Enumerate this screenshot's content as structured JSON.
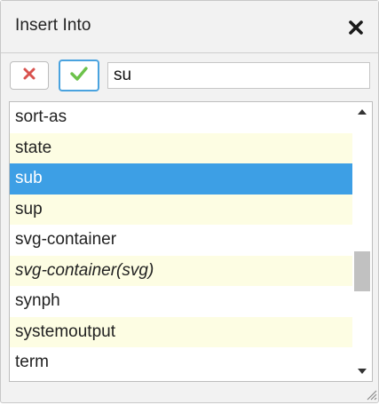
{
  "dialog": {
    "title": "Insert Into"
  },
  "toolbar": {
    "search_value": "su"
  },
  "list": {
    "items": [
      "sort-as",
      "state",
      "sub",
      "sup",
      "svg-container",
      "svg-container(svg)",
      "synph",
      "systemoutput",
      "term"
    ],
    "selected": "sub"
  },
  "colors": {
    "selection": "#3d9fe5",
    "alt_row": "#fdfde3",
    "cancel_icon": "#d9534f",
    "ok_icon": "#6cc24a",
    "ok_border": "#4aa3df"
  },
  "icons": {
    "close": "close-icon",
    "cancel": "x-icon",
    "ok": "checkmark-icon",
    "scroll_up": "chevron-up-icon",
    "scroll_down": "chevron-down-icon",
    "resize": "resize-grip-icon"
  }
}
